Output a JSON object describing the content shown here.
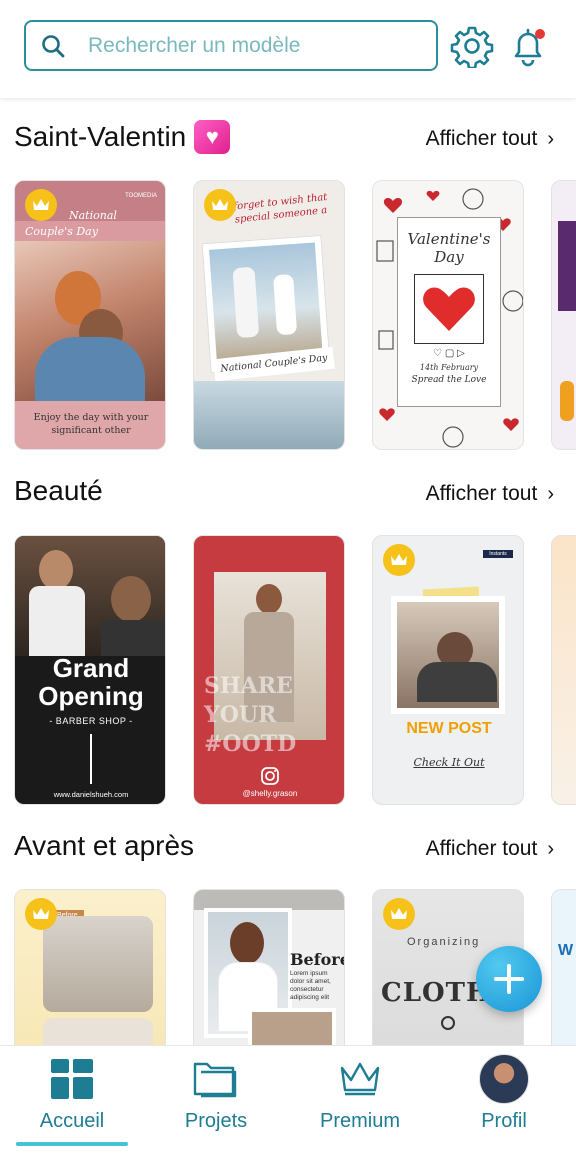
{
  "search": {
    "placeholder": "Rechercher un modèle"
  },
  "header": {
    "settings_icon": "gear-icon",
    "notifications_icon": "bell-icon",
    "notification_badge_color": "#e53935"
  },
  "sections": [
    {
      "title": "Saint-Valentin",
      "emoji": "heart-emoji",
      "see_all": "Afficher tout",
      "cards": [
        {
          "premium": true,
          "line1": "National",
          "line2": "Couple's Day",
          "footer": "Enjoy the day with your significant other",
          "logo": "TOOMEDIA"
        },
        {
          "premium": true,
          "header": "forget to wish that special someone a",
          "caption": "National Couple's Day"
        },
        {
          "premium": false,
          "title1": "Valentine's",
          "title2": "Day",
          "date": "14th February",
          "tagline": "Spread the Love"
        },
        {
          "premium": false
        }
      ]
    },
    {
      "title": "Beauté",
      "see_all": "Afficher tout",
      "cards": [
        {
          "premium": false,
          "title1": "Grand",
          "title2": "Opening",
          "subtitle": "- BARBER SHOP -",
          "url": "www.danielshueh.com"
        },
        {
          "premium": false,
          "text1": "SHARE",
          "text2": "YOUR",
          "text3": "#OOTD",
          "handle": "@shelly.grason"
        },
        {
          "premium": true,
          "badge": "Instants",
          "title": "NEW POST",
          "cta": "Check It Out"
        },
        {
          "premium": false
        }
      ]
    },
    {
      "title": "Avant et après",
      "see_all": "Afficher tout",
      "cards": [
        {
          "premium": true,
          "tag": "Before"
        },
        {
          "premium": false,
          "title": "Before",
          "body": "Lorem ipsum dolor sit amet, consectetur adipiscing elit"
        },
        {
          "premium": true,
          "subtitle": "Organizing",
          "title": "CLOTH"
        },
        {
          "premium": false,
          "letter": "W"
        }
      ]
    }
  ],
  "fab": {
    "icon": "plus-icon"
  },
  "bottom_nav": [
    {
      "label": "Accueil",
      "icon": "home-grid-icon",
      "active": true
    },
    {
      "label": "Projets",
      "icon": "folder-icon",
      "active": false
    },
    {
      "label": "Premium",
      "icon": "crown-icon",
      "active": false
    },
    {
      "label": "Profil",
      "icon": "avatar",
      "active": false
    }
  ],
  "colors": {
    "accent": "#1e7d93",
    "search_border": "#2b8f9a",
    "premium": "#f6c21a",
    "fab": "#1995d6"
  }
}
